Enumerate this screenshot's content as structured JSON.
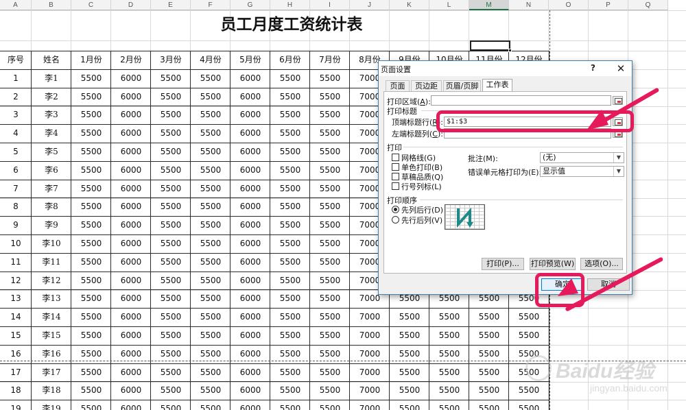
{
  "sheet": {
    "title": "员工月度工资统计表",
    "columns": [
      "A",
      "B",
      "C",
      "D",
      "E",
      "F",
      "G",
      "H",
      "I",
      "J",
      "K",
      "L",
      "M",
      "N",
      "O",
      "P",
      "Q"
    ],
    "selected_column": "M",
    "headers": [
      "序号",
      "姓名",
      "1月份",
      "2月份",
      "3月份",
      "4月份",
      "5月份",
      "6月份",
      "7月份",
      "8月份",
      "9月份",
      "10月份",
      "11月份",
      "12月份"
    ],
    "rows": [
      [
        "1",
        "李1",
        "5500",
        "6000",
        "5500",
        "5500",
        "6000",
        "5500",
        "5500",
        "7000",
        "",
        "",
        "",
        ""
      ],
      [
        "2",
        "李2",
        "5500",
        "6000",
        "5500",
        "5500",
        "6000",
        "5500",
        "5500",
        "7000",
        "",
        "",
        "",
        ""
      ],
      [
        "3",
        "李3",
        "5500",
        "6000",
        "5500",
        "5500",
        "6000",
        "5500",
        "5500",
        "7000",
        "",
        "",
        "",
        ""
      ],
      [
        "4",
        "李4",
        "5500",
        "6000",
        "5500",
        "5500",
        "6000",
        "5500",
        "5500",
        "7000",
        "",
        "",
        "",
        ""
      ],
      [
        "5",
        "李5",
        "5500",
        "6000",
        "5500",
        "5500",
        "6000",
        "5500",
        "5500",
        "7000",
        "",
        "",
        "",
        ""
      ],
      [
        "6",
        "李6",
        "5500",
        "6000",
        "5500",
        "5500",
        "6000",
        "5500",
        "5500",
        "7000",
        "",
        "",
        "",
        ""
      ],
      [
        "7",
        "李7",
        "5500",
        "6000",
        "5500",
        "5500",
        "6000",
        "5500",
        "5500",
        "7000",
        "",
        "",
        "",
        ""
      ],
      [
        "8",
        "李8",
        "5500",
        "6000",
        "5500",
        "5500",
        "6000",
        "5500",
        "5500",
        "7000",
        "",
        "",
        "",
        ""
      ],
      [
        "9",
        "李9",
        "5500",
        "6000",
        "5500",
        "5500",
        "6000",
        "5500",
        "5500",
        "7000",
        "",
        "",
        "",
        ""
      ],
      [
        "10",
        "李10",
        "5500",
        "6000",
        "5500",
        "5500",
        "6000",
        "5500",
        "5500",
        "7000",
        "",
        "",
        "",
        ""
      ],
      [
        "11",
        "李11",
        "5500",
        "6000",
        "5500",
        "5500",
        "6000",
        "5500",
        "5500",
        "7000",
        "",
        "",
        "",
        ""
      ],
      [
        "12",
        "李12",
        "5500",
        "6000",
        "5500",
        "5500",
        "6000",
        "5500",
        "5500",
        "7000",
        "",
        "",
        "",
        ""
      ],
      [
        "13",
        "李13",
        "5500",
        "6000",
        "5500",
        "5500",
        "6000",
        "5500",
        "5500",
        "7000",
        "5500",
        "5500",
        "5500",
        "5500"
      ],
      [
        "14",
        "李14",
        "5500",
        "6000",
        "5500",
        "5500",
        "6000",
        "5500",
        "5500",
        "7000",
        "5500",
        "5500",
        "5500",
        "5500"
      ],
      [
        "15",
        "李15",
        "5500",
        "6000",
        "5500",
        "5500",
        "6000",
        "5500",
        "5500",
        "7000",
        "5500",
        "5500",
        "5500",
        "5500"
      ],
      [
        "16",
        "李16",
        "5500",
        "6000",
        "5500",
        "5500",
        "6000",
        "5500",
        "5500",
        "7000",
        "5500",
        "5500",
        "5500",
        "5500"
      ],
      [
        "17",
        "李17",
        "5500",
        "6000",
        "5500",
        "5500",
        "6000",
        "5500",
        "5500",
        "7000",
        "5500",
        "5500",
        "5500",
        "5500"
      ],
      [
        "18",
        "李18",
        "5500",
        "6000",
        "5500",
        "5500",
        "6000",
        "5500",
        "5500",
        "7000",
        "5500",
        "5500",
        "5500",
        "5500"
      ],
      [
        "19",
        "李19",
        "5500",
        "6000",
        "5500",
        "5500",
        "6000",
        "5500",
        "5500",
        "7000",
        "5500",
        "5500",
        "5500",
        "5500"
      ]
    ]
  },
  "dialog": {
    "title": "页面设置",
    "help": "?",
    "close": "✕",
    "tabs": [
      "页面",
      "页边距",
      "页眉/页脚",
      "工作表"
    ],
    "active_tab": "工作表",
    "print_area": {
      "label": "打印区域(",
      "key": "A",
      "suffix": "):",
      "value": ""
    },
    "print_titles": {
      "group": "打印标题",
      "rows_label": "顶端标题行(",
      "rows_key": "R",
      "rows_suffix": "):",
      "rows_value": "$1:$3",
      "cols_label": "左端标题列(",
      "cols_key": "C",
      "cols_suffix": "):",
      "cols_value": ""
    },
    "print": {
      "group": "打印",
      "gridlines": "网格线(G)",
      "mono": "单色打印(B)",
      "draft": "草稿品质(Q)",
      "headings": "行号列标(L)",
      "comments_label": "批注(M):",
      "comments_value": "(无)",
      "errors_label": "错误单元格打印为(E):",
      "errors_value": "显示值"
    },
    "order": {
      "group": "打印顺序",
      "down_then_over": "先列后行(D)",
      "over_then_down": "先行后列(V)",
      "selected": "down_then_over"
    },
    "buttons": {
      "print": "打印(P)...",
      "preview": "打印预览(W)",
      "options": "选项(O)...",
      "ok": "确定",
      "cancel": "取消"
    }
  },
  "annotation": {
    "color": "#e6195a"
  },
  "watermark": {
    "main": "Baidu经验",
    "sub": "jingyan.baidu.com"
  }
}
